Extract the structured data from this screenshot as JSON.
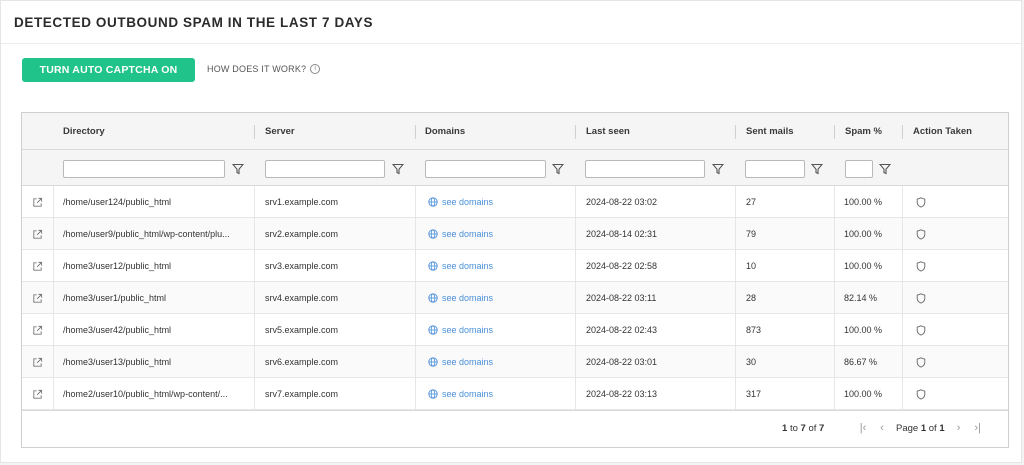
{
  "page": {
    "title": "DETECTED OUTBOUND SPAM IN THE LAST 7 DAYS",
    "captcha_button": "TURN AUTO CAPTCHA ON",
    "how_link": "HOW DOES IT WORK?"
  },
  "table": {
    "columns": [
      "Directory",
      "Server",
      "Domains",
      "Last seen",
      "Sent mails",
      "Spam %",
      "Action Taken"
    ],
    "rows": [
      {
        "directory": "/home/user124/public_html",
        "server": "srv1.example.com",
        "domains": "see domains",
        "last_seen": "2024-08-22 03:02",
        "sent": "27",
        "spam": "100.00 %"
      },
      {
        "directory": "/home/user9/public_html/wp-content/plu...",
        "server": "srv2.example.com",
        "domains": "see domains",
        "last_seen": "2024-08-14 02:31",
        "sent": "79",
        "spam": "100.00 %"
      },
      {
        "directory": "/home3/user12/public_html",
        "server": "srv3.example.com",
        "domains": "see domains",
        "last_seen": "2024-08-22 02:58",
        "sent": "10",
        "spam": "100.00 %"
      },
      {
        "directory": "/home3/user1/public_html",
        "server": "srv4.example.com",
        "domains": "see domains",
        "last_seen": "2024-08-22 03:11",
        "sent": "28",
        "spam": "82.14 %"
      },
      {
        "directory": "/home3/user42/public_html",
        "server": "srv5.example.com",
        "domains": "see domains",
        "last_seen": "2024-08-22 02:43",
        "sent": "873",
        "spam": "100.00 %"
      },
      {
        "directory": "/home3/user13/public_html",
        "server": "srv6.example.com",
        "domains": "see domains",
        "last_seen": "2024-08-22 03:01",
        "sent": "30",
        "spam": "86.67 %"
      },
      {
        "directory": "/home2/user10/public_html/wp-content/...",
        "server": "srv7.example.com",
        "domains": "see domains",
        "last_seen": "2024-08-22 03:13",
        "sent": "317",
        "spam": "100.00 %"
      }
    ]
  },
  "footer": {
    "range_from": "1",
    "range_to": "7",
    "range_word": "to",
    "of_word": "of",
    "total": "7",
    "page_word": "Page",
    "page_current": "1",
    "page_total": "1"
  },
  "colors": {
    "accent": "#20c38a",
    "link": "#4a90d9"
  },
  "icons": {
    "row_open": "external-link-icon",
    "domains": "globe-icon",
    "action": "shield-icon",
    "filter": "filter-icon",
    "info": "info-icon"
  }
}
